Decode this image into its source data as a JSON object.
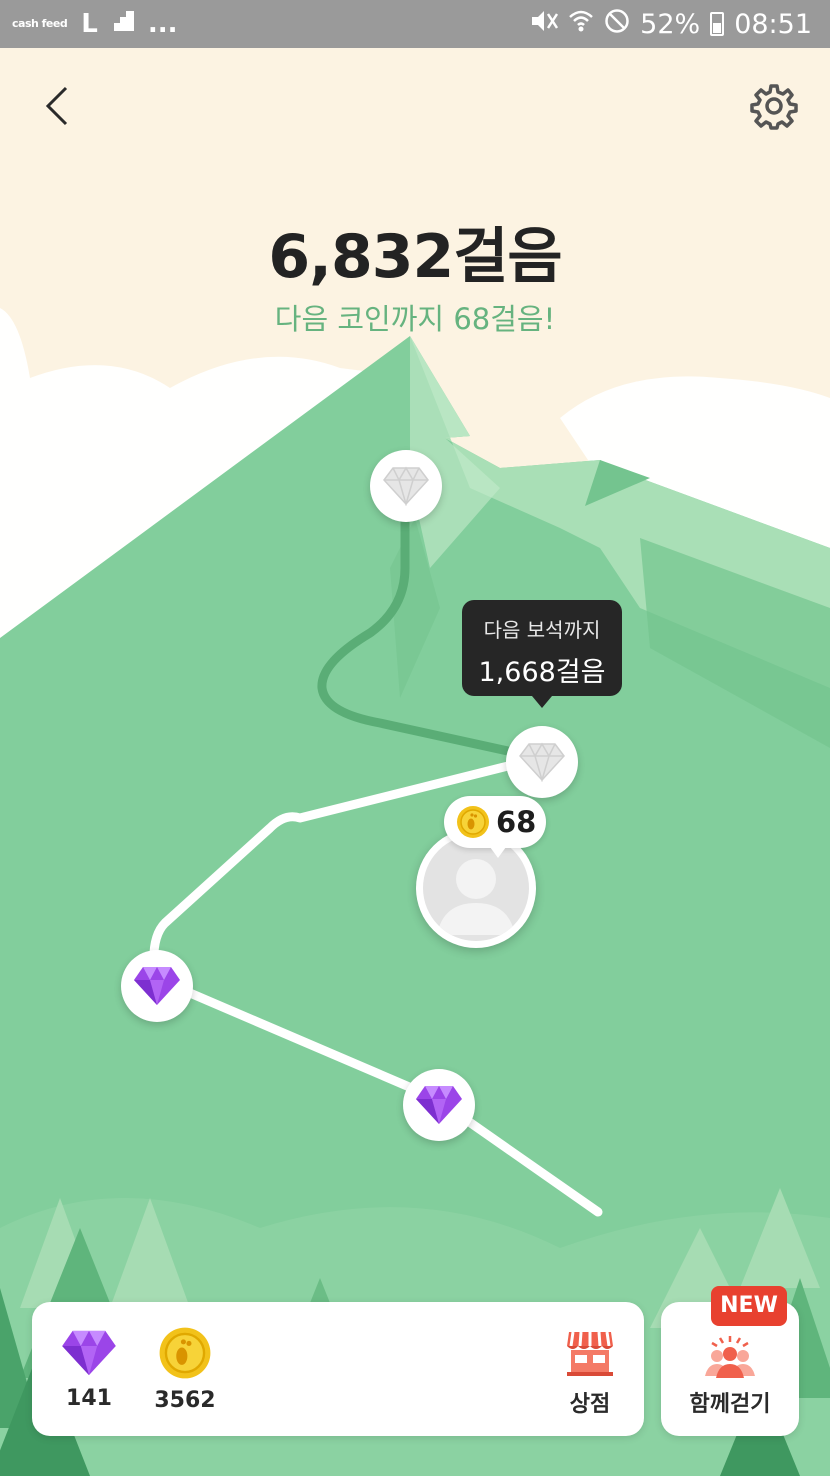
{
  "status_bar": {
    "app_label": "cash feed",
    "left_glyph": "L",
    "more": "...",
    "battery_percent": "52%",
    "time": "08:51",
    "icons": [
      "vibrate-icon",
      "wifi-icon",
      "do-not-disturb-icon",
      "battery-icon"
    ]
  },
  "header": {
    "back_icon": "chevron-left-icon",
    "settings_icon": "gear-icon"
  },
  "steps": {
    "count": "6,832걸음",
    "next_coin": "다음 코인까지 68걸음!"
  },
  "map": {
    "tooltip_line1": "다음 보석까지",
    "tooltip_line2": "1,668걸음",
    "coin_bubble_value": "68",
    "nodes": [
      {
        "kind": "gem",
        "color": "white",
        "state": "locked"
      },
      {
        "kind": "gem",
        "color": "white",
        "state": "locked"
      },
      {
        "kind": "gem",
        "color": "purple",
        "state": "collected"
      },
      {
        "kind": "gem",
        "color": "purple",
        "state": "collected"
      }
    ]
  },
  "bottom_bar": {
    "gems_value": "141",
    "coins_value": "3562",
    "shop_label": "상점",
    "walk_together_label": "함께걷기",
    "new_badge": "NEW"
  },
  "colors": {
    "mountain": "#82ce9c",
    "path_done": "#5aad76",
    "path_next": "#ffffff",
    "accent_text": "#66b37f",
    "badge_red": "#e8412f",
    "sky": "#fcf3e2"
  }
}
